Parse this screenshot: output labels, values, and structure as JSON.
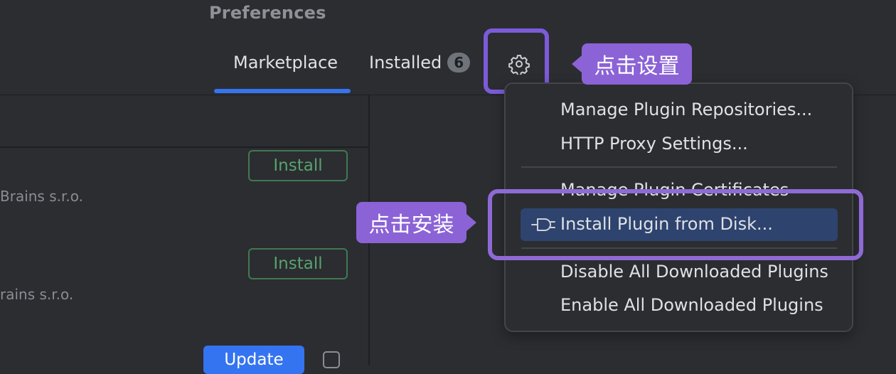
{
  "window": {
    "title": "Preferences"
  },
  "tabs": [
    {
      "label": "Marketplace",
      "active": true
    },
    {
      "label": "Installed",
      "badge": "6"
    }
  ],
  "plugins": [
    {
      "vendor": "Brains s.r.o.",
      "action": "Install"
    },
    {
      "vendor": "rains s.r.o.",
      "action": "Install"
    },
    {
      "action": "Update"
    }
  ],
  "settings_menu": {
    "items": [
      {
        "label": "Manage Plugin Repositories..."
      },
      {
        "label": "HTTP Proxy Settings..."
      },
      {
        "label": "Manage Plugin Certificates"
      },
      {
        "label": "Install Plugin from Disk...",
        "icon": "plug-icon",
        "selected": true
      },
      {
        "label": "Disable All Downloaded Plugins"
      },
      {
        "label": "Enable All Downloaded Plugins"
      }
    ]
  },
  "annotations": {
    "settings": "点击设置",
    "install": "点击安装"
  },
  "colors": {
    "background": "#2b2d30",
    "accent": "#3574f0",
    "install_green": "#58a26f",
    "highlight_purple": "#7c5bd9",
    "selected_row": "#2e436e"
  }
}
